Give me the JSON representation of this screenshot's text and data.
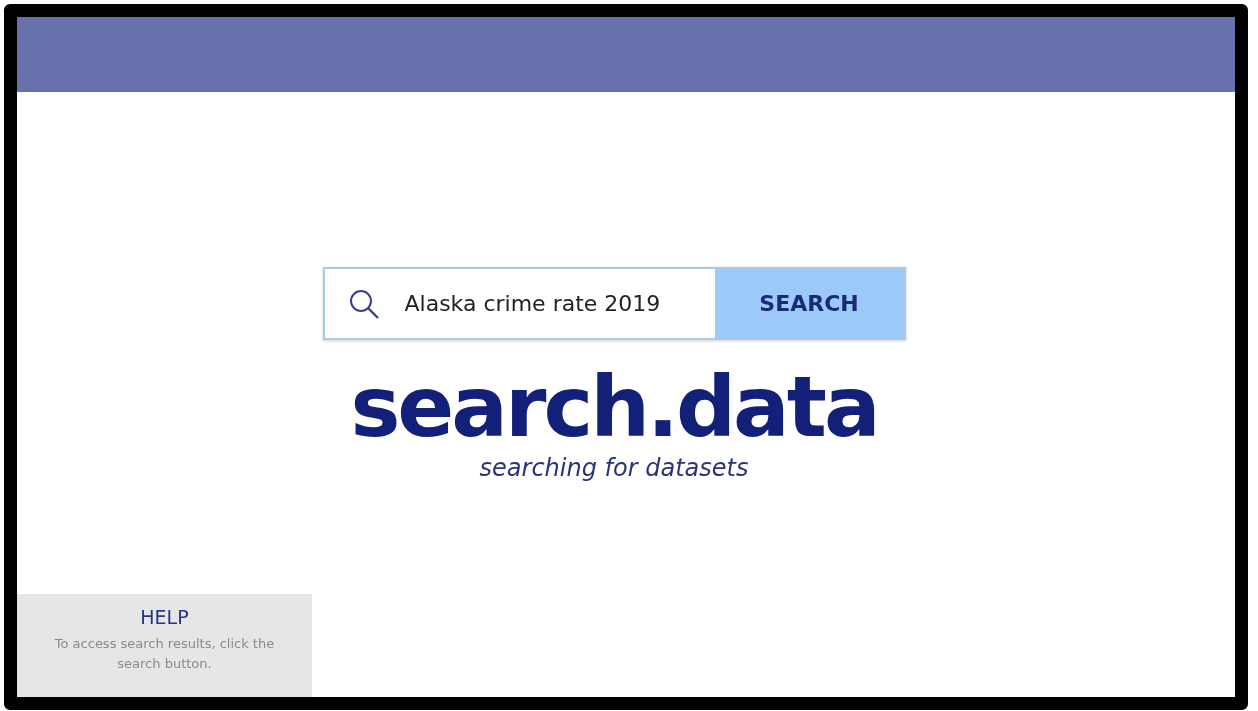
{
  "search": {
    "value": "Alaska crime rate 2019",
    "button": "SEARCH"
  },
  "logo": {
    "title": "search.data",
    "tagline": "searching for datasets"
  },
  "help": {
    "title": "HELP",
    "text": "To access search results, click the search button."
  }
}
